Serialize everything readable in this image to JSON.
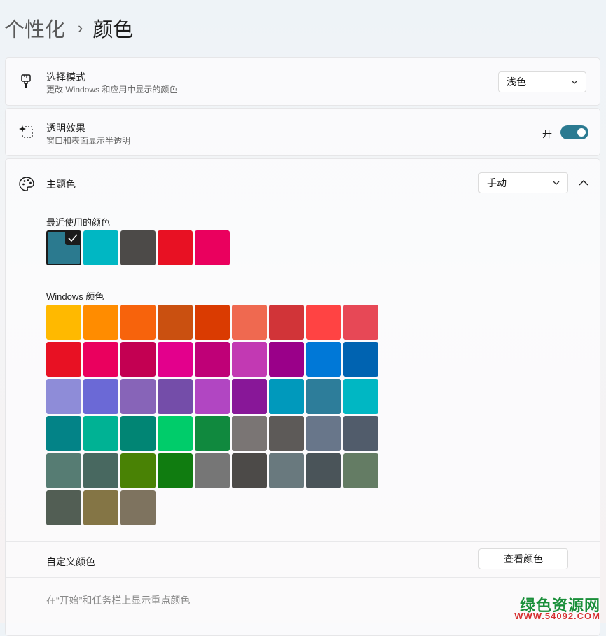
{
  "breadcrumb": {
    "parent": "个性化",
    "separator": "›",
    "current": "颜色"
  },
  "mode": {
    "icon": "brush-icon",
    "title": "选择模式",
    "subtitle": "更改 Windows 和应用中显示的颜色",
    "value": "浅色"
  },
  "transparency": {
    "icon": "sparkle-icon",
    "title": "透明效果",
    "subtitle": "窗口和表面显示半透明",
    "toggle_label": "开",
    "enabled": true
  },
  "accent": {
    "icon": "palette-icon",
    "title": "主题色",
    "value": "手动",
    "expanded": true,
    "recent_label": "最近使用的颜色",
    "recent_colors": [
      "#2b7a8f",
      "#00b7c3",
      "#4c4a48",
      "#e81123",
      "#ea005e"
    ],
    "selected_recent_index": 0,
    "windows_label": "Windows 颜色",
    "windows_colors": [
      "#ffb900",
      "#ff8c00",
      "#f7630c",
      "#ca5010",
      "#da3b01",
      "#ef6950",
      "#d13438",
      "#ff4343",
      "#e74856",
      "#e81123",
      "#ea005e",
      "#c30052",
      "#e3008c",
      "#bf0077",
      "#c239b3",
      "#9a0089",
      "#0078d7",
      "#0063b1",
      "#8e8cd8",
      "#6b69d6",
      "#8764b8",
      "#744da9",
      "#b146c2",
      "#881798",
      "#0099bc",
      "#2d7d9a",
      "#00b7c3",
      "#038387",
      "#00b294",
      "#018574",
      "#00cc6a",
      "#10893e",
      "#7a7574",
      "#5d5a58",
      "#68768a",
      "#515c6b",
      "#567c73",
      "#486860",
      "#498205",
      "#107c10",
      "#767676",
      "#4c4a48",
      "#69797e",
      "#4a5459",
      "#647c64",
      "#525e54",
      "#847545",
      "#7e735f"
    ],
    "custom_label": "自定义颜色",
    "view_colors_button": "查看颜色",
    "taskbar_label": "在“开始”和任务栏上显示重点颜色"
  },
  "watermark": {
    "title": "绿色资源网",
    "url": "WWW.54092.COM"
  }
}
